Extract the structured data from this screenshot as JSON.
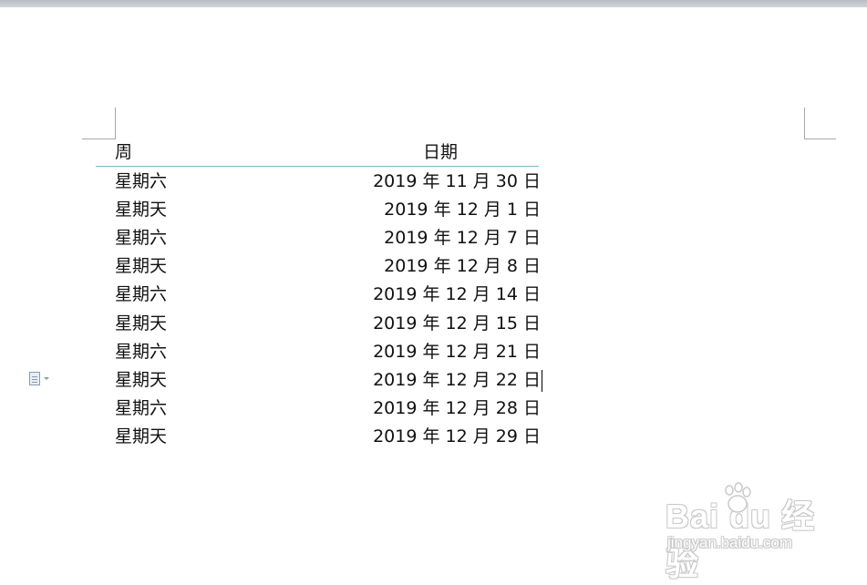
{
  "table": {
    "headers": {
      "week": "周",
      "date": "日期"
    },
    "rows": [
      {
        "week": "星期六",
        "date": "2019 年 11 月 30 日"
      },
      {
        "week": "星期天",
        "date": "2019 年 12 月 1 日"
      },
      {
        "week": "星期六",
        "date": "2019 年 12 月 7 日"
      },
      {
        "week": "星期天",
        "date": "2019 年 12 月 8 日"
      },
      {
        "week": "星期六",
        "date": "2019 年 12 月 14 日"
      },
      {
        "week": "星期天",
        "date": "2019 年 12 月 15 日"
      },
      {
        "week": "星期六",
        "date": "2019 年 12 月 21 日"
      },
      {
        "week": "星期天",
        "date": "2019 年 12 月 22 日"
      },
      {
        "week": "星期六",
        "date": "2019 年 12 月 28 日"
      },
      {
        "week": "星期天",
        "date": "2019 年 12 月 29 日"
      }
    ]
  },
  "watermark": {
    "logo_text": "Bai du 经验",
    "url": "jingyan.baidu.com"
  },
  "icons": {
    "paste_options": "paste-options-icon"
  },
  "colors": {
    "header_rule": "#7fb6c8",
    "top_bar": "#c4c7cd"
  }
}
